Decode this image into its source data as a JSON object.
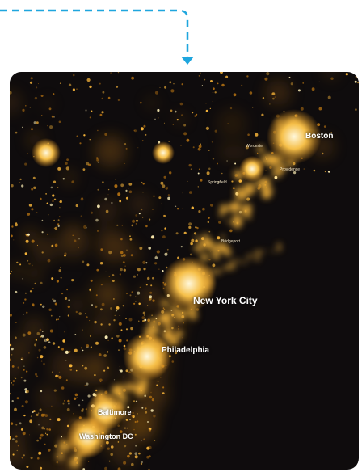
{
  "map": {
    "cities": {
      "boston": "Boston",
      "new_york_city": "New York City",
      "philadelphia": "Philadelphia",
      "baltimore": "Baltimore",
      "washington_dc": "Washington DC"
    },
    "minor_cities": {
      "worcester": "Worcester",
      "providence": "Providence",
      "springfield": "Springfield",
      "bridgeport": "Bridgeport"
    }
  },
  "colors": {
    "connector": "#1fa6de",
    "ocean": "#0f0c0d",
    "light_bright": "#fff1b8",
    "light_mid": "#f4b33a",
    "light_dim": "#a86a12"
  }
}
